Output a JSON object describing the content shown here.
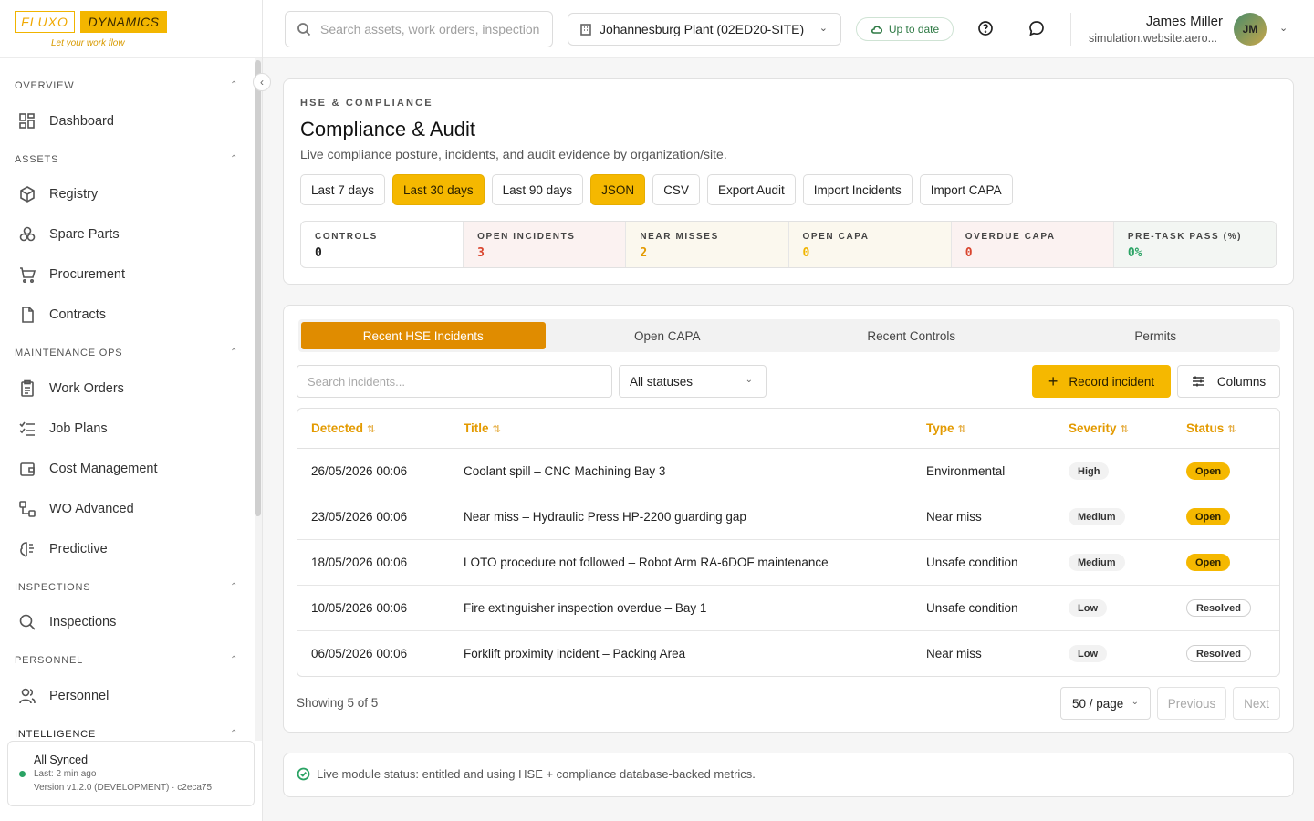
{
  "logo": {
    "part1": "FLUXO",
    "part2": "DYNAMICS",
    "tagline": "Let your work flow"
  },
  "sidebar": {
    "sections": [
      {
        "label": "OVERVIEW",
        "items": [
          {
            "label": "Dashboard",
            "icon": "grid-icon"
          }
        ]
      },
      {
        "label": "ASSETS",
        "items": [
          {
            "label": "Registry",
            "icon": "cube-icon"
          },
          {
            "label": "Spare Parts",
            "icon": "parts-icon"
          },
          {
            "label": "Procurement",
            "icon": "cart-icon"
          },
          {
            "label": "Contracts",
            "icon": "document-icon"
          }
        ]
      },
      {
        "label": "MAINTENANCE OPS",
        "items": [
          {
            "label": "Work Orders",
            "icon": "clipboard-icon"
          },
          {
            "label": "Job Plans",
            "icon": "list-check-icon"
          },
          {
            "label": "Cost Management",
            "icon": "wallet-icon"
          },
          {
            "label": "WO Advanced",
            "icon": "workflow-icon"
          },
          {
            "label": "Predictive",
            "icon": "brain-icon"
          }
        ]
      },
      {
        "label": "INSPECTIONS",
        "items": [
          {
            "label": "Inspections",
            "icon": "search-icon"
          }
        ]
      },
      {
        "label": "PERSONNEL",
        "items": [
          {
            "label": "Personnel",
            "icon": "users-icon"
          }
        ]
      },
      {
        "label": "INTELLIGENCE",
        "items": []
      }
    ],
    "sync": {
      "title": "All Synced",
      "last": "Last: 2 min ago",
      "version": "Version v1.2.0 (DEVELOPMENT) · c2eca75"
    }
  },
  "header": {
    "search_placeholder": "Search assets, work orders, inspections...",
    "site": "Johannesburg Plant (02ED20-SITE)",
    "sync_status": "Up to date",
    "user_name": "James Miller",
    "user_email": "simulation.website.aero...",
    "user_initials": "JM"
  },
  "page": {
    "eyebrow": "HSE & COMPLIANCE",
    "title": "Compliance & Audit",
    "subtitle": "Live compliance posture, incidents, and audit evidence by organization/site.",
    "buttons": [
      "Last 7 days",
      "Last 30 days",
      "Last 90 days",
      "JSON",
      "CSV",
      "Export Audit",
      "Import Incidents",
      "Import CAPA"
    ],
    "stats": [
      {
        "label": "CONTROLS",
        "value": "0",
        "color": "#222222"
      },
      {
        "label": "OPEN INCIDENTS",
        "value": "3",
        "color": "#d9452e"
      },
      {
        "label": "NEAR MISSES",
        "value": "2",
        "color": "#e39a00"
      },
      {
        "label": "OPEN CAPA",
        "value": "0",
        "color": "#f0b400"
      },
      {
        "label": "OVERDUE CAPA",
        "value": "0",
        "color": "#d9452e"
      },
      {
        "label": "PRE-TASK PASS (%)",
        "value": "0%",
        "color": "#2aa364"
      }
    ]
  },
  "incidents": {
    "tabs": [
      "Recent HSE Incidents",
      "Open CAPA",
      "Recent Controls",
      "Permits"
    ],
    "search_placeholder": "Search incidents...",
    "status_filter": "All statuses",
    "record_label": "Record incident",
    "columns_label": "Columns",
    "headers": {
      "detected": "Detected",
      "title": "Title",
      "type": "Type",
      "severity": "Severity",
      "status": "Status"
    },
    "rows": [
      {
        "detected": "26/05/2026 00:06",
        "title": "Coolant spill – CNC Machining Bay 3",
        "type": "Environmental",
        "severity": "High",
        "status": "Open"
      },
      {
        "detected": "23/05/2026 00:06",
        "title": "Near miss – Hydraulic Press HP-2200 guarding gap",
        "type": "Near miss",
        "severity": "Medium",
        "status": "Open"
      },
      {
        "detected": "18/05/2026 00:06",
        "title": "LOTO procedure not followed – Robot Arm RA-6DOF maintenance",
        "type": "Unsafe condition",
        "severity": "Medium",
        "status": "Open"
      },
      {
        "detected": "10/05/2026 00:06",
        "title": "Fire extinguisher inspection overdue – Bay 1",
        "type": "Unsafe condition",
        "severity": "Low",
        "status": "Resolved"
      },
      {
        "detected": "06/05/2026 00:06",
        "title": "Forklift proximity incident – Packing Area",
        "type": "Near miss",
        "severity": "Low",
        "status": "Resolved"
      }
    ],
    "showing": "Showing 5 of 5",
    "per_page": "50 / page",
    "prev": "Previous",
    "next": "Next"
  },
  "footer": {
    "live_status": "Live module status: entitled and using HSE + compliance database-backed metrics."
  }
}
